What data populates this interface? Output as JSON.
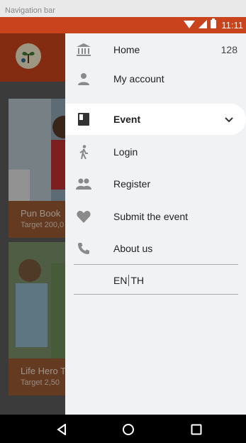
{
  "caption": {
    "text": "Navigation bar"
  },
  "status_bar": {
    "time": "11:11",
    "icons": [
      "wifi-icon",
      "signal-icon",
      "battery-icon"
    ]
  },
  "background": {
    "cards": [
      {
        "title": "Pun Book",
        "target": "Target 200,0"
      },
      {
        "title": "Life Hero T",
        "target": "Target 2,50"
      }
    ]
  },
  "drawer": {
    "items": [
      {
        "icon": "bank-icon",
        "label": "Home",
        "count": "128"
      },
      {
        "icon": "person-icon",
        "label": "My account"
      },
      {
        "icon": "book-icon",
        "label": "Event",
        "active": true
      },
      {
        "icon": "walking-icon",
        "label": "Login"
      },
      {
        "icon": "people-icon",
        "label": "Register"
      },
      {
        "icon": "heart-icon",
        "label": "Submit the event"
      },
      {
        "icon": "phone-icon",
        "label": "About us"
      }
    ],
    "language": {
      "en": "EN",
      "th": "TH"
    }
  },
  "colors": {
    "brand": "#c9441c",
    "drawer_bg": "#f0f2f4",
    "icon": "#8a8a8a"
  },
  "nav_bar": {
    "buttons": [
      "back-icon",
      "home-circle-icon",
      "recents-square-icon"
    ]
  }
}
